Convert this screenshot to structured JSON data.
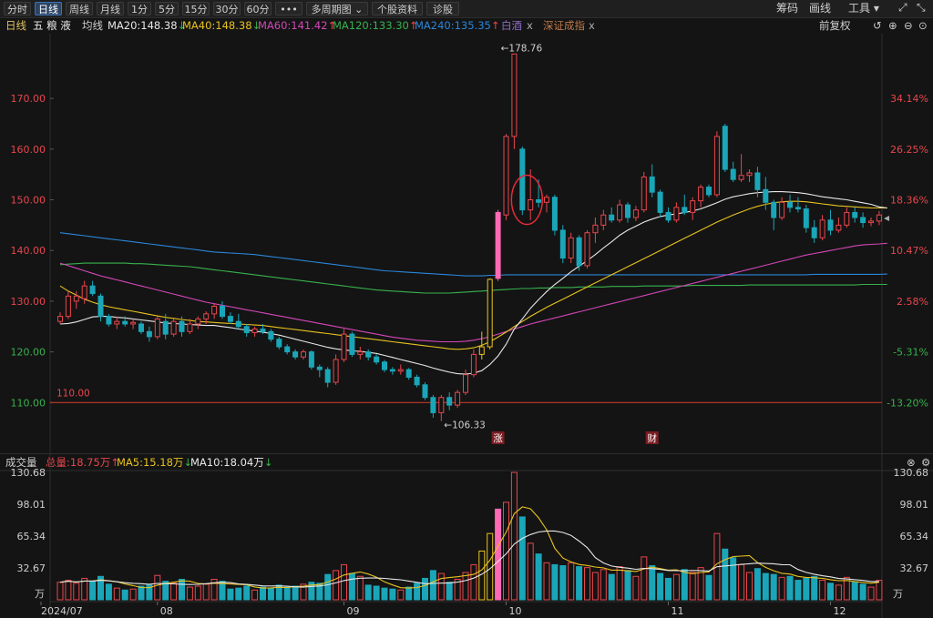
{
  "toolbar": {
    "tabs": [
      "分时",
      "日线",
      "周线",
      "月线",
      "1分",
      "5分",
      "15分",
      "30分",
      "60分",
      "•••",
      "多周期图 ⌄",
      "个股资料",
      "诊股"
    ],
    "active_tab": "日线",
    "right": [
      "筹码",
      "画线",
      "工具 ▾"
    ]
  },
  "info": {
    "period": "日线",
    "stock": "五 粮 液",
    "avg_label": "均线",
    "ma20": "MA20:148.38",
    "ma40": "MA40:148.38",
    "ma60": "MA60:141.42",
    "ma120": "MA120:133.30",
    "ma240": "MA240:135.35",
    "cmp1": "白酒",
    "cmp2": "深证成指",
    "close_x": "x",
    "adjust": "前复权"
  },
  "volume_info": {
    "title": "成交量",
    "total": "总量:18.75万",
    "ma5": "MA5:15.18万",
    "ma10": "MA10:18.04万"
  },
  "colors": {
    "up": "#e8464d",
    "down": "#1aa6b8",
    "ma20": "#e8e8e8",
    "ma40": "#e8c21f",
    "ma60": "#d447b8",
    "ma120": "#37b24d",
    "ma240": "#2b85d8",
    "limit": "#ff69b4"
  },
  "chart_data": {
    "type": "candlestick",
    "title": "",
    "price_axis": {
      "ylim": [
        104.5,
        180
      ],
      "left_ticks": [
        "170.00",
        "160.00",
        "150.00",
        "140.00",
        "130.00",
        "120.00",
        "110.00"
      ],
      "right_ticks": [
        "34.14%",
        "26.25%",
        "18.36%",
        "10.47%",
        "2.58%",
        "-5.31%",
        "-13.20%"
      ]
    },
    "x_labels": [
      "2024/07",
      "08",
      "09",
      "10",
      "11",
      "12"
    ],
    "annotations": {
      "high": "←178.76",
      "low": "←106.33",
      "ref_line": "110.00",
      "markers": [
        "涨",
        "财"
      ]
    },
    "volume_axis": {
      "ylim": [
        0,
        130.68
      ],
      "ticks": [
        "130.68",
        "98.01",
        "65.34",
        "32.67"
      ],
      "unit": "万"
    },
    "candles": [
      {
        "o": 126,
        "h": 127.8,
        "l": 125.5,
        "c": 127,
        "v": 18
      },
      {
        "o": 127,
        "h": 132,
        "l": 126.5,
        "c": 131,
        "v": 20
      },
      {
        "o": 130,
        "h": 132,
        "l": 128.5,
        "c": 131,
        "v": 17
      },
      {
        "o": 130.5,
        "h": 134,
        "l": 129.5,
        "c": 133,
        "v": 22
      },
      {
        "o": 133,
        "h": 134,
        "l": 131,
        "c": 131.5,
        "v": 19
      },
      {
        "o": 131,
        "h": 131.5,
        "l": 126,
        "c": 127,
        "v": 24
      },
      {
        "o": 127,
        "h": 127.5,
        "l": 125,
        "c": 125.5,
        "v": 16
      },
      {
        "o": 125.5,
        "h": 127,
        "l": 124.5,
        "c": 126,
        "v": 12
      },
      {
        "o": 126,
        "h": 127,
        "l": 125,
        "c": 125.5,
        "v": 10
      },
      {
        "o": 125.5,
        "h": 126.5,
        "l": 124.5,
        "c": 125.8,
        "v": 11
      },
      {
        "o": 125.5,
        "h": 126,
        "l": 123.5,
        "c": 124,
        "v": 14
      },
      {
        "o": 124,
        "h": 125,
        "l": 122,
        "c": 123,
        "v": 15
      },
      {
        "o": 123,
        "h": 127,
        "l": 122.5,
        "c": 126.5,
        "v": 25
      },
      {
        "o": 126,
        "h": 127.5,
        "l": 122.5,
        "c": 123.5,
        "v": 19
      },
      {
        "o": 123.5,
        "h": 126.5,
        "l": 123,
        "c": 126,
        "v": 17
      },
      {
        "o": 126,
        "h": 127,
        "l": 123,
        "c": 124,
        "v": 21
      },
      {
        "o": 124,
        "h": 126.5,
        "l": 123.5,
        "c": 125.5,
        "v": 13
      },
      {
        "o": 125.5,
        "h": 127,
        "l": 124.5,
        "c": 126.5,
        "v": 14
      },
      {
        "o": 126.5,
        "h": 128,
        "l": 125.5,
        "c": 127.5,
        "v": 16
      },
      {
        "o": 127.5,
        "h": 129.5,
        "l": 126.5,
        "c": 129,
        "v": 21
      },
      {
        "o": 129,
        "h": 130,
        "l": 126.5,
        "c": 127,
        "v": 19
      },
      {
        "o": 127,
        "h": 127.8,
        "l": 125.5,
        "c": 126,
        "v": 11
      },
      {
        "o": 126,
        "h": 127.5,
        "l": 124.5,
        "c": 125,
        "v": 12
      },
      {
        "o": 125,
        "h": 125.5,
        "l": 123,
        "c": 123.8,
        "v": 14
      },
      {
        "o": 123.8,
        "h": 125,
        "l": 123,
        "c": 124.5,
        "v": 10
      },
      {
        "o": 124.5,
        "h": 125.5,
        "l": 123.5,
        "c": 124,
        "v": 13
      },
      {
        "o": 124,
        "h": 124.5,
        "l": 122,
        "c": 122.5,
        "v": 12
      },
      {
        "o": 122.5,
        "h": 123,
        "l": 120.5,
        "c": 121,
        "v": 15
      },
      {
        "o": 121,
        "h": 121.5,
        "l": 119.5,
        "c": 120,
        "v": 13
      },
      {
        "o": 120,
        "h": 120.5,
        "l": 118.5,
        "c": 119,
        "v": 14
      },
      {
        "o": 119,
        "h": 120.5,
        "l": 118.5,
        "c": 120,
        "v": 16
      },
      {
        "o": 120,
        "h": 120.3,
        "l": 116.5,
        "c": 117,
        "v": 18
      },
      {
        "o": 117,
        "h": 117.5,
        "l": 115,
        "c": 116.5,
        "v": 17
      },
      {
        "o": 116.5,
        "h": 117,
        "l": 113,
        "c": 114,
        "v": 26
      },
      {
        "o": 114,
        "h": 119.5,
        "l": 113.5,
        "c": 118.5,
        "v": 30
      },
      {
        "o": 118.5,
        "h": 124.5,
        "l": 118,
        "c": 123.5,
        "v": 36
      },
      {
        "o": 123.5,
        "h": 124,
        "l": 119,
        "c": 119.5,
        "v": 27
      },
      {
        "o": 119.5,
        "h": 121,
        "l": 118.5,
        "c": 120,
        "v": 24
      },
      {
        "o": 120,
        "h": 120.5,
        "l": 118.3,
        "c": 119,
        "v": 15
      },
      {
        "o": 119,
        "h": 119.5,
        "l": 117.5,
        "c": 118,
        "v": 14
      },
      {
        "o": 118,
        "h": 118.4,
        "l": 116,
        "c": 116.5,
        "v": 12
      },
      {
        "o": 116.5,
        "h": 117,
        "l": 115.5,
        "c": 116.2,
        "v": 11
      },
      {
        "o": 116.2,
        "h": 117.5,
        "l": 115.5,
        "c": 116.5,
        "v": 10
      },
      {
        "o": 116.5,
        "h": 116.8,
        "l": 114.5,
        "c": 115,
        "v": 13
      },
      {
        "o": 115,
        "h": 115.5,
        "l": 113,
        "c": 113.5,
        "v": 17
      },
      {
        "o": 113.5,
        "h": 114,
        "l": 110.5,
        "c": 111,
        "v": 22
      },
      {
        "o": 111,
        "h": 111.5,
        "l": 107,
        "c": 108,
        "v": 30
      },
      {
        "o": 108,
        "h": 111.5,
        "l": 106.33,
        "c": 111,
        "v": 27
      },
      {
        "o": 111,
        "h": 112,
        "l": 108.5,
        "c": 109.5,
        "v": 18
      },
      {
        "o": 109.5,
        "h": 112.5,
        "l": 109,
        "c": 112,
        "v": 21
      },
      {
        "o": 112,
        "h": 116.5,
        "l": 111.5,
        "c": 115.5,
        "v": 28
      },
      {
        "o": 115.5,
        "h": 120.5,
        "l": 115,
        "c": 119.5,
        "v": 36
      },
      {
        "o": 119.5,
        "h": 124,
        "l": 118.5,
        "c": 121,
        "v": 50
      },
      {
        "o": 121,
        "h": 134.5,
        "l": 120.5,
        "c": 134.3,
        "v": 68
      },
      {
        "o": 134.5,
        "h": 148,
        "l": 134,
        "c": 147.5,
        "v": 93
      },
      {
        "o": 147,
        "h": 163,
        "l": 146,
        "c": 162.5,
        "v": 100
      },
      {
        "o": 162.5,
        "h": 178.76,
        "l": 160,
        "c": 178.76,
        "v": 130.68
      },
      {
        "o": 160,
        "h": 160.5,
        "l": 147,
        "c": 148,
        "v": 85
      },
      {
        "o": 148,
        "h": 156,
        "l": 146,
        "c": 150,
        "v": 58
      },
      {
        "o": 150,
        "h": 154,
        "l": 148.5,
        "c": 149.5,
        "v": 47
      },
      {
        "o": 149.5,
        "h": 151,
        "l": 147.5,
        "c": 150.5,
        "v": 38
      },
      {
        "o": 150.5,
        "h": 151,
        "l": 143,
        "c": 144,
        "v": 36
      },
      {
        "o": 144,
        "h": 145,
        "l": 137.5,
        "c": 138.5,
        "v": 35
      },
      {
        "o": 138.5,
        "h": 143.5,
        "l": 137.5,
        "c": 142.5,
        "v": 38
      },
      {
        "o": 142.5,
        "h": 143,
        "l": 136,
        "c": 137,
        "v": 34
      },
      {
        "o": 137,
        "h": 144,
        "l": 136.5,
        "c": 143.5,
        "v": 33
      },
      {
        "o": 143.5,
        "h": 146.5,
        "l": 141.5,
        "c": 145,
        "v": 28
      },
      {
        "o": 145,
        "h": 148,
        "l": 144,
        "c": 147,
        "v": 31
      },
      {
        "o": 147,
        "h": 148.5,
        "l": 145.5,
        "c": 146,
        "v": 26
      },
      {
        "o": 146,
        "h": 150,
        "l": 145.5,
        "c": 149,
        "v": 34
      },
      {
        "o": 149,
        "h": 149.5,
        "l": 145.5,
        "c": 146.5,
        "v": 30
      },
      {
        "o": 146.5,
        "h": 148.8,
        "l": 145.8,
        "c": 148,
        "v": 24
      },
      {
        "o": 148,
        "h": 155.5,
        "l": 147.5,
        "c": 154.5,
        "v": 44
      },
      {
        "o": 154.5,
        "h": 157,
        "l": 150.5,
        "c": 151.5,
        "v": 35
      },
      {
        "o": 151.5,
        "h": 152,
        "l": 146.5,
        "c": 147.5,
        "v": 27
      },
      {
        "o": 147.5,
        "h": 148.5,
        "l": 145.5,
        "c": 146,
        "v": 22
      },
      {
        "o": 146,
        "h": 149.5,
        "l": 145.5,
        "c": 148.5,
        "v": 26
      },
      {
        "o": 148.5,
        "h": 151,
        "l": 147,
        "c": 147.5,
        "v": 31
      },
      {
        "o": 147.5,
        "h": 150.5,
        "l": 146,
        "c": 149.8,
        "v": 28
      },
      {
        "o": 149.8,
        "h": 153,
        "l": 148.5,
        "c": 152.5,
        "v": 33
      },
      {
        "o": 152.5,
        "h": 153,
        "l": 150.5,
        "c": 151,
        "v": 25
      },
      {
        "o": 151,
        "h": 163.5,
        "l": 150.5,
        "c": 162.5,
        "v": 68
      },
      {
        "o": 164.5,
        "h": 165,
        "l": 155.5,
        "c": 156,
        "v": 52
      },
      {
        "o": 156,
        "h": 157.5,
        "l": 153.5,
        "c": 154,
        "v": 43
      },
      {
        "o": 154,
        "h": 159,
        "l": 153.5,
        "c": 154.8,
        "v": 36
      },
      {
        "o": 154.8,
        "h": 156,
        "l": 153.5,
        "c": 155.3,
        "v": 28
      },
      {
        "o": 155.3,
        "h": 156.5,
        "l": 150.5,
        "c": 152,
        "v": 32
      },
      {
        "o": 152,
        "h": 154.5,
        "l": 148,
        "c": 149.5,
        "v": 27
      },
      {
        "o": 149.5,
        "h": 150,
        "l": 144,
        "c": 146.5,
        "v": 26
      },
      {
        "o": 146.5,
        "h": 150.5,
        "l": 146,
        "c": 149.5,
        "v": 23
      },
      {
        "o": 149.5,
        "h": 151,
        "l": 147.5,
        "c": 148.5,
        "v": 24
      },
      {
        "o": 148.5,
        "h": 150.5,
        "l": 147.5,
        "c": 148.2,
        "v": 20
      },
      {
        "o": 148.2,
        "h": 149,
        "l": 143.5,
        "c": 144.5,
        "v": 22
      },
      {
        "o": 144.5,
        "h": 146,
        "l": 141.5,
        "c": 142.5,
        "v": 24
      },
      {
        "o": 142.5,
        "h": 147,
        "l": 142,
        "c": 146,
        "v": 20
      },
      {
        "o": 146,
        "h": 148,
        "l": 143,
        "c": 144,
        "v": 17
      },
      {
        "o": 144,
        "h": 146.5,
        "l": 143.5,
        "c": 145,
        "v": 15
      },
      {
        "o": 145,
        "h": 148.5,
        "l": 144.5,
        "c": 147.5,
        "v": 23
      },
      {
        "o": 147.5,
        "h": 148.5,
        "l": 145.5,
        "c": 146.5,
        "v": 18
      },
      {
        "o": 146.5,
        "h": 147.5,
        "l": 144.5,
        "c": 145.5,
        "v": 16
      },
      {
        "o": 145.5,
        "h": 146.5,
        "l": 144.8,
        "c": 145.8,
        "v": 13
      },
      {
        "o": 145.8,
        "h": 147.8,
        "l": 145,
        "c": 147,
        "v": 20
      }
    ],
    "ma20": [
      125.5,
      125.6,
      125.9,
      126.4,
      126.9,
      127.0,
      127.0,
      126.8,
      126.7,
      126.5,
      126.3,
      126.1,
      125.9,
      125.7,
      125.6,
      125.5,
      125.4,
      125.3,
      125.2,
      125.2,
      125.0,
      124.8,
      124.5,
      124.3,
      124.1,
      123.9,
      123.6,
      123.3,
      122.9,
      122.5,
      122.1,
      121.7,
      121.3,
      120.9,
      120.6,
      120.4,
      120.2,
      120.1,
      119.9,
      119.7,
      119.3,
      118.9,
      118.5,
      118.1,
      117.7,
      117.3,
      116.8,
      116.4,
      116.0,
      115.7,
      115.6,
      115.8,
      116.3,
      117.5,
      119.2,
      121.5,
      124.5,
      126.5,
      128.6,
      130.3,
      131.9,
      133.3,
      134.5,
      135.8,
      136.9,
      138.0,
      139.2,
      140.5,
      141.7,
      143.0,
      144.0,
      144.8,
      145.6,
      146.2,
      146.7,
      147.0,
      147.2,
      147.5,
      147.8,
      148.2,
      148.8,
      149.4,
      150.1,
      150.6,
      150.9,
      151.2,
      151.4,
      151.5,
      151.6,
      151.6,
      151.5,
      151.4,
      151.2,
      150.9,
      150.6,
      150.4,
      150.2,
      150.0,
      149.7,
      149.4,
      149.1,
      148.6,
      148.38
    ],
    "ma40": [
      133,
      132,
      131.2,
      130.4,
      129.8,
      129.3,
      128.9,
      128.6,
      128.3,
      128.0,
      127.7,
      127.4,
      127.1,
      126.8,
      126.6,
      126.4,
      126.2,
      126.0,
      125.9,
      125.8,
      125.7,
      125.6,
      125.5,
      125.4,
      125.3,
      125.2,
      125.0,
      124.8,
      124.6,
      124.4,
      124.2,
      124.0,
      123.8,
      123.6,
      123.4,
      123.2,
      123.0,
      122.8,
      122.6,
      122.4,
      122.2,
      122.0,
      121.8,
      121.6,
      121.4,
      121.2,
      121.0,
      120.8,
      120.6,
      120.5,
      120.6,
      120.8,
      121.3,
      122.0,
      122.9,
      123.9,
      125.0,
      126.0,
      127.0,
      127.9,
      128.8,
      129.6,
      130.4,
      131.2,
      132.0,
      132.8,
      133.6,
      134.4,
      135.2,
      136.0,
      136.8,
      137.6,
      138.4,
      139.2,
      140.0,
      140.8,
      141.6,
      142.4,
      143.2,
      144.0,
      144.8,
      145.6,
      146.3,
      147.0,
      147.6,
      148.2,
      148.7,
      149.1,
      149.4,
      149.6,
      149.7,
      149.7,
      149.6,
      149.4,
      149.2,
      149.0,
      148.8,
      148.7,
      148.6,
      148.5,
      148.4,
      148.38,
      148.38
    ],
    "ma60": [
      137.5,
      137.0,
      136.5,
      136.0,
      135.5,
      135.0,
      134.6,
      134.2,
      133.8,
      133.4,
      133.0,
      132.6,
      132.2,
      131.8,
      131.4,
      131.0,
      130.6,
      130.2,
      129.8,
      129.5,
      129.2,
      128.9,
      128.6,
      128.3,
      128.0,
      127.7,
      127.4,
      127.1,
      126.8,
      126.5,
      126.2,
      125.9,
      125.6,
      125.3,
      125.0,
      124.7,
      124.4,
      124.1,
      123.8,
      123.5,
      123.2,
      122.9,
      122.7,
      122.5,
      122.3,
      122.2,
      122.1,
      122.0,
      122.0,
      122.0,
      122.1,
      122.3,
      122.6,
      123.0,
      123.5,
      124.0,
      124.5,
      125.0,
      125.5,
      125.9,
      126.3,
      126.7,
      127.1,
      127.5,
      127.9,
      128.3,
      128.7,
      129.1,
      129.5,
      129.9,
      130.3,
      130.7,
      131.1,
      131.5,
      131.9,
      132.3,
      132.7,
      133.1,
      133.5,
      133.9,
      134.3,
      134.7,
      135.1,
      135.5,
      135.9,
      136.3,
      136.7,
      137.1,
      137.5,
      137.9,
      138.3,
      138.7,
      139.1,
      139.4,
      139.7,
      140.0,
      140.3,
      140.6,
      140.9,
      141.1,
      141.2,
      141.3,
      141.42
    ],
    "ma120": [
      137.2,
      137.3,
      137.4,
      137.5,
      137.5,
      137.5,
      137.5,
      137.5,
      137.5,
      137.4,
      137.4,
      137.3,
      137.2,
      137.1,
      137.0,
      136.9,
      136.8,
      136.6,
      136.4,
      136.2,
      136.0,
      135.8,
      135.6,
      135.4,
      135.2,
      135.0,
      134.8,
      134.6,
      134.4,
      134.2,
      134.0,
      133.8,
      133.6,
      133.4,
      133.2,
      133.0,
      132.8,
      132.6,
      132.4,
      132.2,
      132.1,
      132.0,
      131.9,
      131.8,
      131.7,
      131.6,
      131.6,
      131.6,
      131.6,
      131.7,
      131.8,
      131.9,
      132.0,
      132.1,
      132.2,
      132.3,
      132.4,
      132.5,
      132.5,
      132.6,
      132.6,
      132.7,
      132.7,
      132.7,
      132.8,
      132.8,
      132.8,
      132.8,
      132.9,
      132.9,
      132.9,
      132.9,
      133.0,
      133.0,
      133.0,
      133.0,
      133.0,
      133.0,
      133.1,
      133.1,
      133.1,
      133.1,
      133.1,
      133.1,
      133.1,
      133.2,
      133.2,
      133.2,
      133.2,
      133.2,
      133.2,
      133.2,
      133.2,
      133.2,
      133.2,
      133.2,
      133.2,
      133.2,
      133.2,
      133.3,
      133.3,
      133.3,
      133.3
    ],
    "ma240": [
      143.5,
      143.3,
      143.1,
      142.9,
      142.7,
      142.5,
      142.3,
      142.1,
      141.9,
      141.7,
      141.5,
      141.3,
      141.1,
      140.9,
      140.7,
      140.5,
      140.3,
      140.1,
      139.9,
      139.7,
      139.6,
      139.5,
      139.4,
      139.3,
      139.2,
      139.0,
      138.8,
      138.6,
      138.4,
      138.2,
      138.0,
      137.8,
      137.6,
      137.4,
      137.2,
      137.0,
      136.8,
      136.6,
      136.4,
      136.2,
      136.0,
      135.9,
      135.8,
      135.7,
      135.6,
      135.5,
      135.4,
      135.3,
      135.2,
      135.1,
      135.0,
      135.0,
      135.0,
      135.1,
      135.1,
      135.2,
      135.2,
      135.2,
      135.2,
      135.2,
      135.2,
      135.2,
      135.2,
      135.2,
      135.2,
      135.2,
      135.2,
      135.2,
      135.2,
      135.2,
      135.2,
      135.2,
      135.2,
      135.2,
      135.2,
      135.2,
      135.2,
      135.2,
      135.2,
      135.2,
      135.2,
      135.2,
      135.2,
      135.2,
      135.2,
      135.2,
      135.2,
      135.2,
      135.2,
      135.2,
      135.2,
      135.2,
      135.2,
      135.3,
      135.3,
      135.3,
      135.3,
      135.3,
      135.3,
      135.3,
      135.3,
      135.3,
      135.35
    ]
  }
}
